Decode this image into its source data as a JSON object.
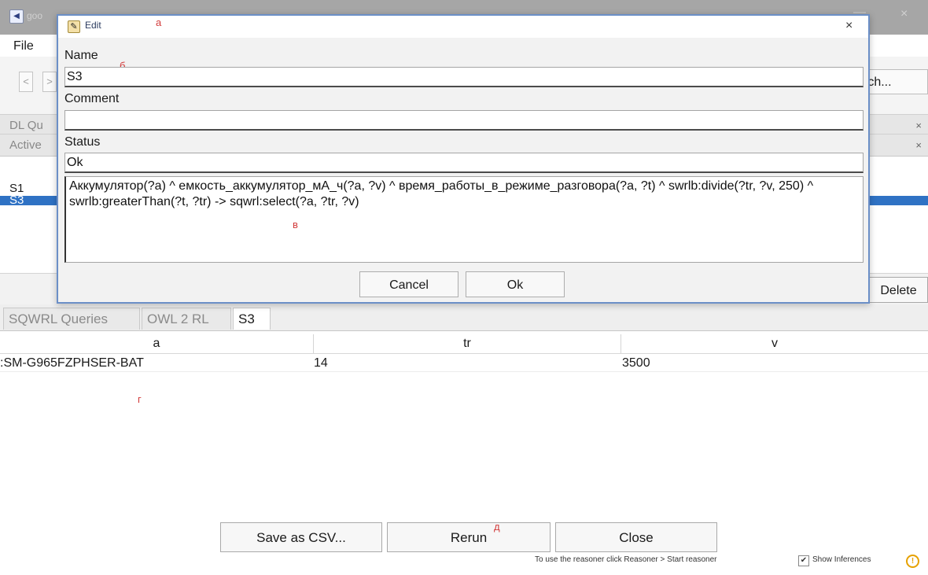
{
  "app": {
    "title": "goo",
    "min_glyph": "—",
    "close_glyph": "×",
    "menu": {
      "file": "File"
    }
  },
  "toolbar": {
    "back": "<",
    "forward": ">",
    "search_label": "rch..."
  },
  "panels": {
    "dl_query": "DL Qu",
    "active": "Active",
    "close_glyph": "×"
  },
  "queries": {
    "items": [
      {
        "label": "S1",
        "selected": false
      },
      {
        "label": "S3",
        "selected": true
      }
    ],
    "delete_label": "Delete"
  },
  "tabs": [
    {
      "label": "SQWRL Queries",
      "active": false
    },
    {
      "label": "OWL 2 RL",
      "active": false
    },
    {
      "label": "S3",
      "active": true
    }
  ],
  "results": {
    "columns": [
      "a",
      "tr",
      "v"
    ],
    "rows": [
      [
        ":SM-G965FZPHSER-BAT",
        "14",
        "3500"
      ]
    ]
  },
  "bottom_buttons": {
    "save_csv": "Save as CSV...",
    "rerun": "Rerun",
    "close": "Close"
  },
  "status_bar": {
    "hint": "To use the reasoner click Reasoner > Start reasoner",
    "checkbox_checked": true,
    "checkbox_glyph": "✔",
    "show_inferences": "Show Inferences",
    "warning_glyph": "!"
  },
  "annotations": {
    "a": "а",
    "b": "б",
    "v": "в",
    "g": "г",
    "d": "д"
  },
  "dialog": {
    "title": "Edit",
    "close_glyph": "×",
    "name_label": "Name",
    "name_value": "S3",
    "comment_label": "Comment",
    "comment_value": "",
    "status_label": "Status",
    "status_value": "Ok",
    "rule_text": "Аккумулятор(?a) ^ емкость_аккумулятор_мА_ч(?a, ?v) ^ время_работы_в_режиме_разговора(?a, ?t) ^ swrlb:divide(?tr, ?v, 250) ^ swrlb:greaterThan(?t, ?tr) -> sqwrl:select(?a, ?tr, ?v)",
    "cancel_label": "Cancel",
    "ok_label": "Ok"
  },
  "colors": {
    "selection": "#2f72c4",
    "dialog_border": "#6b8fc7",
    "annotation_red": "#d23b3b",
    "warning": "#e6a100"
  }
}
